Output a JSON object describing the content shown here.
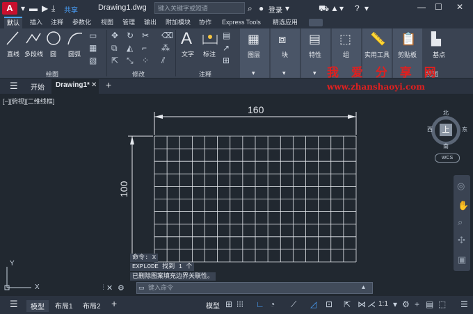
{
  "titlebar": {
    "app_letter": "A",
    "share_label": "共享",
    "doc_name": "Drawing1.dwg",
    "search_placeholder": "键入关键字或短语",
    "login_label": "登录"
  },
  "ribbon_tabs": [
    "默认",
    "插入",
    "注释",
    "参数化",
    "视图",
    "管理",
    "输出",
    "附加模块",
    "协作",
    "Express Tools",
    "精选应用"
  ],
  "ribbon": {
    "draw_items": [
      "直线",
      "多段线",
      "圆",
      "圆弧"
    ],
    "draw_panel": "绘图",
    "modify_panel": "修改",
    "annotation_items": [
      "文字",
      "标注"
    ],
    "annotation_panel": "注释",
    "layer_label": "图层",
    "block_label": "块",
    "props_label": "特性",
    "group_label": "组",
    "utility_label": "实用工具",
    "clipboard_label": "剪贴板",
    "base_label": "基点",
    "view_panel": "视图"
  },
  "watermark": {
    "line1": "我 爱 分 享 网",
    "line2": "www.zhanshaoyi.com"
  },
  "file_tabs": {
    "start": "开始",
    "drawing": "Drawing1*"
  },
  "viewport": {
    "label": "[−][俯视][二维线框]",
    "dim_width": "160",
    "dim_height": "100",
    "grid_cols": 16,
    "grid_rows": 10
  },
  "viewcube": {
    "north": "北",
    "south": "南",
    "east": "东",
    "west": "西",
    "face": "上",
    "wcs": "WCS"
  },
  "command": {
    "line1": "命令: X",
    "line2": "EXPLODE 找到 1 个",
    "line3": "已删除图案填充边界关联性。",
    "input_placeholder": "键入命令"
  },
  "statusbar": {
    "model_tab": "模型",
    "layout1": "布局1",
    "layout2": "布局2",
    "model_btn": "模型",
    "scale": "1:1"
  }
}
